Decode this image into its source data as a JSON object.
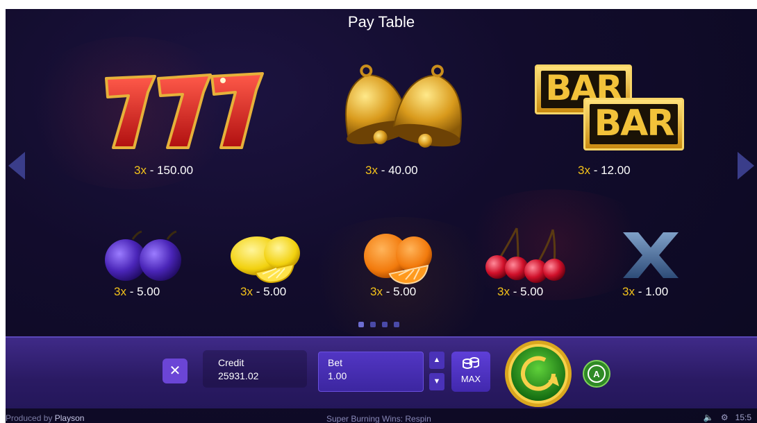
{
  "title": "Pay Table",
  "page_indicator": {
    "count": 4,
    "active": 0
  },
  "top_row": [
    {
      "symbol": "seven-777",
      "multiplier": "3x",
      "payout": "- 150.00"
    },
    {
      "symbol": "bells",
      "multiplier": "3x",
      "payout": "- 40.00"
    },
    {
      "symbol": "bar-bar",
      "multiplier": "3x",
      "payout": "- 12.00"
    }
  ],
  "bottom_row": [
    {
      "symbol": "plum",
      "multiplier": "3x",
      "payout": "- 5.00"
    },
    {
      "symbol": "lemon",
      "multiplier": "3x",
      "payout": "- 5.00"
    },
    {
      "symbol": "orange",
      "multiplier": "3x",
      "payout": "- 5.00"
    },
    {
      "symbol": "cherry",
      "multiplier": "3x",
      "payout": "- 5.00"
    },
    {
      "symbol": "x-symbol",
      "multiplier": "3x",
      "payout": "- 1.00"
    }
  ],
  "bar_text": {
    "bar1": "BAR",
    "bar2": "BAR"
  },
  "controls": {
    "close_label": "✕",
    "credit_label": "Credit",
    "credit_value": "25931.02",
    "bet_label": "Bet",
    "bet_value": "1.00",
    "max_label": "MAX",
    "auto_label": "A"
  },
  "footer": {
    "produced_by": "Produced by",
    "brand": "Playson",
    "game_title": "Super Burning Wins: Respin",
    "clock": "15:5"
  },
  "colors": {
    "multiplier": "#f3c21a",
    "accent": "#6b45d6",
    "spin_green": "#1f7a1f"
  }
}
